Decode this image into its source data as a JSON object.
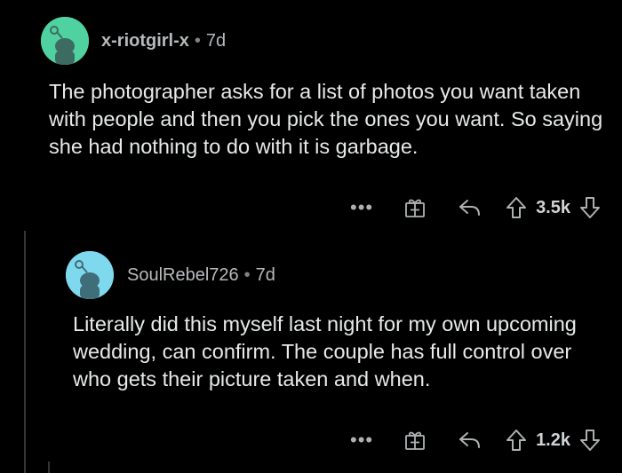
{
  "comments": [
    {
      "username": "x-riotgirl-x",
      "separator": "•",
      "time": "7d",
      "body": "The photographer asks for a list of photos you want taken with people and then you pick the ones you want. So saying she had nothing to do with it is garbage.",
      "more": "•••",
      "score": "3.5k",
      "avatar_color": "#4fd1a0"
    },
    {
      "username": "SoulRebel726",
      "separator": "•",
      "time": "7d",
      "body": "Literally did this myself last night for my own upcoming wedding, can confirm. The couple has full control over who gets their picture taken and when.",
      "more": "•••",
      "score": "1.2k",
      "avatar_color": "#7fd9ee"
    }
  ],
  "icons": {
    "more": "more-options-icon",
    "award": "gift-award-icon",
    "reply": "reply-arrow-icon",
    "upvote": "upvote-arrow-icon",
    "downvote": "downvote-arrow-icon",
    "avatar": "snoo-avatar-icon"
  }
}
